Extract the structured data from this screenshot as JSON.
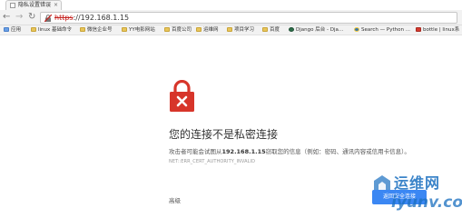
{
  "tab": {
    "title": "隐私设置错误"
  },
  "toolbar": {
    "url_protocol": "https",
    "url_rest": "://192.168.1.15"
  },
  "bookmarks": [
    {
      "label": "应用",
      "icon": "apps-grid-icon"
    },
    {
      "label": "linux 基础命令",
      "icon": "folder-icon"
    },
    {
      "label": "微信企业号",
      "icon": "folder-icon"
    },
    {
      "label": "YY电影网站",
      "icon": "folder-icon"
    },
    {
      "label": "百度公司",
      "icon": "folder-icon"
    },
    {
      "label": "运维网",
      "icon": "folder-icon"
    },
    {
      "label": "项目学习",
      "icon": "folder-icon"
    },
    {
      "label": "百度",
      "icon": "folder-icon"
    },
    {
      "label": "Django 后台 - Dja...",
      "icon": "django-icon"
    },
    {
      "label": "Search — Python ...",
      "icon": "python-icon"
    },
    {
      "label": "bottle | linux系",
      "icon": "bottle-icon"
    }
  ],
  "page": {
    "headline": "您的连接不是私密连接",
    "desc_before": "攻击者可能会试图从",
    "desc_host": "192.168.1.15",
    "desc_after": "窃取您的信息（例如：密码、通讯内容或信用卡信息）。",
    "error_code": "NET::ERR_CERT_AUTHORITY_INVALID",
    "advanced": "高级",
    "back_button": "返回安全连接"
  },
  "watermark": {
    "name": "运维网",
    "url": "iyunv.com"
  },
  "colors": {
    "warning_red": "#d7352a",
    "button_blue": "#3b87f3",
    "watermark_blue": "#1a6fc0"
  }
}
